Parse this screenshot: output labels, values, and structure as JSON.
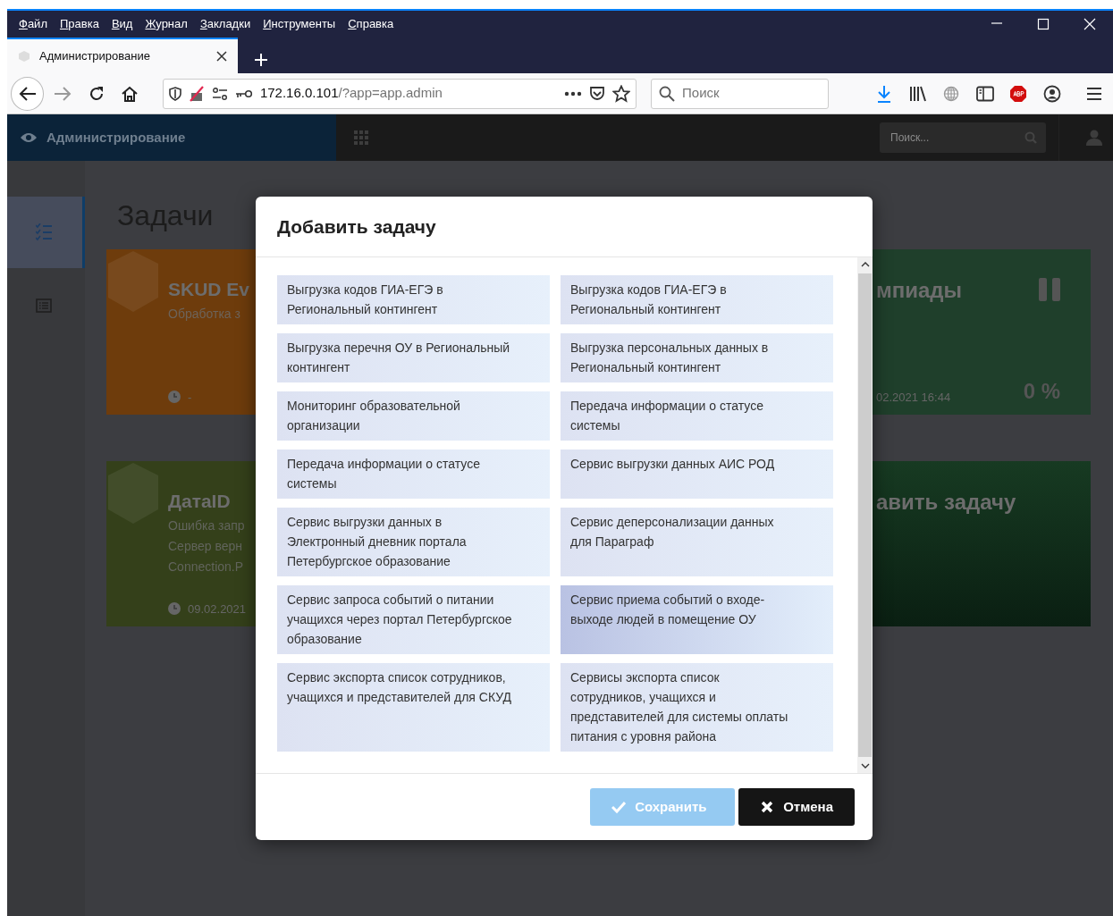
{
  "browser": {
    "menu": [
      "Файл",
      "Правка",
      "Вид",
      "Журнал",
      "Закладки",
      "Инструменты",
      "Справка"
    ],
    "tabs": [
      {
        "title": "Администрирование",
        "selected": true
      }
    ],
    "address": {
      "host": "172.16.0.101",
      "path": "/?app=app.admin"
    },
    "search": {
      "placeholder": "Поиск"
    }
  },
  "app": {
    "brand": "Администрирование",
    "search": {
      "placeholder": "Поиск..."
    },
    "sidebar": [
      {
        "kind": "tasks",
        "selected": true
      },
      {
        "kind": "list",
        "selected": false
      }
    ],
    "page_title": "Задачи",
    "left_cards": [
      {
        "title": "SKUD Ev",
        "description": [
          "Обработка з"
        ],
        "time": "-",
        "color": "#6e3c0c"
      },
      {
        "title": "ДатаID",
        "description": [
          "Ошибка запр",
          "Сервер верн",
          "Connection.P"
        ],
        "time": "09.02.2021",
        "color": "#34401a"
      }
    ],
    "right_cards": [
      {
        "title": "мпиады",
        "time": "02.2021 16:44",
        "progress": "0 %",
        "paused": true,
        "color": "#1f3f2b"
      },
      {
        "title": "авить задачу",
        "paused": false,
        "color": "#173a22"
      }
    ]
  },
  "modal": {
    "title": "Добавить задачу",
    "items": [
      {
        "label": "Выгрузка кодов ГИА-ЕГЭ в Региональный контингент",
        "selected": false
      },
      {
        "label": "Выгрузка кодов ГИА-ЕГЭ в Региональный контингент",
        "selected": false
      },
      {
        "label": "Выгрузка перечня ОУ в Региональный контингент",
        "selected": false
      },
      {
        "label": "Выгрузка персональных данных в Региональный контингент",
        "selected": false
      },
      {
        "label": "Мониторинг образовательной организации",
        "selected": false
      },
      {
        "label": "Передача информации о статусе системы",
        "selected": false
      },
      {
        "label": "Передача информации о статусе системы",
        "selected": false
      },
      {
        "label": "Сервис выгрузки данных АИС РОД",
        "selected": false
      },
      {
        "label": "Сервис выгрузки данных в Электронный дневник портала Петербургское образование",
        "selected": false
      },
      {
        "label": "Сервис деперсонализации данных для Параграф",
        "selected": false
      },
      {
        "label": "Сервис запроса событий о питании учащихся через портал Петербургское образование",
        "selected": false
      },
      {
        "label": "Сервис приема событий о входе-выходе людей в помещение ОУ",
        "selected": true
      },
      {
        "label": "Сервис экспорта список сотрудников, учащихся и представителей для СКУД",
        "selected": false
      },
      {
        "label": "Сервисы экспорта список сотрудников, учащихся и представителей для системы оплаты питания с уровня района",
        "selected": false
      }
    ],
    "buttons": [
      {
        "label": "Сохранить",
        "kind": "save",
        "disabled": true
      },
      {
        "label": "Отмена",
        "kind": "cancel",
        "disabled": false
      }
    ]
  }
}
